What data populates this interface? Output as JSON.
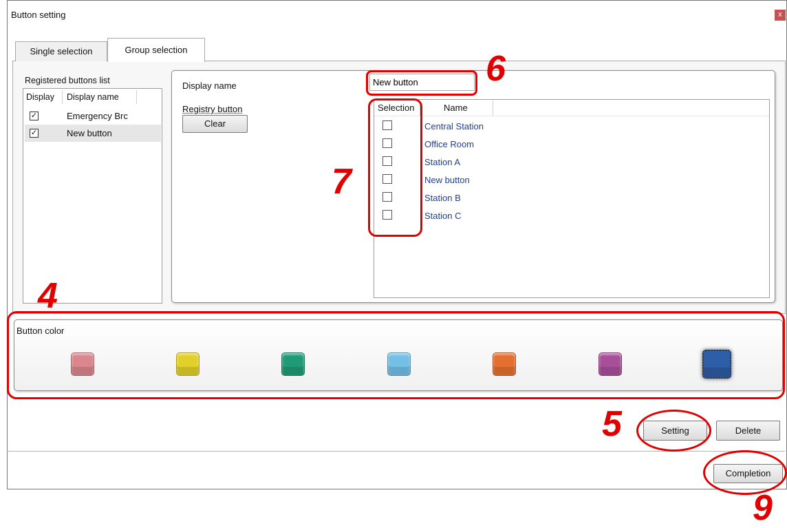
{
  "window": {
    "title": "Button setting",
    "close_glyph": "x"
  },
  "tabs": [
    {
      "label": "Single selection",
      "active": false
    },
    {
      "label": "Group selection",
      "active": true
    }
  ],
  "registered_list": {
    "label": "Registered buttons list",
    "columns": [
      "Display",
      "Display name"
    ],
    "rows": [
      {
        "display": true,
        "check_glyph": "✓",
        "name": "Emergency Brc"
      },
      {
        "display": true,
        "check_glyph": "✓",
        "name": "New button",
        "selected": true
      }
    ]
  },
  "detail": {
    "display_name_label": "Display name",
    "display_name_value": "New button",
    "registry_button_label": "Registry button",
    "clear_label": "Clear",
    "grid": {
      "columns": [
        "Selection",
        "Name"
      ],
      "rows": [
        {
          "selected": false,
          "name": "Central Station"
        },
        {
          "selected": false,
          "name": "Office Room"
        },
        {
          "selected": false,
          "name": "Station A"
        },
        {
          "selected": false,
          "name": "New button"
        },
        {
          "selected": false,
          "name": "Station B"
        },
        {
          "selected": false,
          "name": "Station C"
        }
      ]
    }
  },
  "button_color": {
    "label": "Button color",
    "swatches": [
      {
        "name": "pink",
        "color": "#d9868d"
      },
      {
        "name": "yellow",
        "color": "#e2d02a"
      },
      {
        "name": "green",
        "color": "#1f9b76"
      },
      {
        "name": "light-blue",
        "color": "#74bfe6"
      },
      {
        "name": "orange",
        "color": "#e3702f"
      },
      {
        "name": "purple",
        "color": "#a84f9a"
      },
      {
        "name": "blue",
        "color": "#2f5ea8",
        "selected": true
      }
    ]
  },
  "actions": {
    "setting": "Setting",
    "delete": "Delete",
    "completion": "Completion"
  },
  "callouts": {
    "four": "4",
    "five": "5",
    "six": "6",
    "seven": "7",
    "nine": "9"
  },
  "colors": {
    "callout_red": "#e00000",
    "link_blue": "#1c3f95"
  }
}
